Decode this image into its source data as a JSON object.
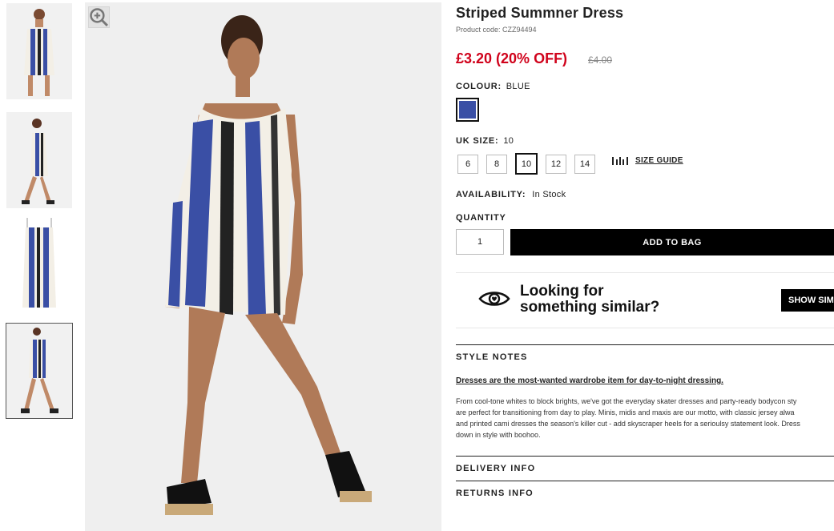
{
  "product": {
    "title": "Striped Summner Dress",
    "code": "Product code: CZZ94494",
    "price": "£3.20 (20% OFF)",
    "old_price": "£4.00"
  },
  "colour": {
    "label": "COLOUR:",
    "value": "BLUE",
    "swatch": "#3a4fa5"
  },
  "size": {
    "label": "UK SIZE:",
    "value": "10",
    "options": [
      "6",
      "8",
      "10",
      "12",
      "14"
    ],
    "guide": "SIZE GUIDE"
  },
  "availability": {
    "label": "AVAILABILITY:",
    "value": "In Stock"
  },
  "quantity": {
    "label": "QUANTITY",
    "value": "1"
  },
  "add_to_bag": "ADD TO BAG",
  "similar": {
    "line1": "Looking for",
    "line2": "something similar?",
    "button": "SHOW SIM"
  },
  "style_notes": {
    "heading": "STYLE NOTES",
    "lead": "Dresses are the most-wanted wardrobe item for day-to-night dressing.",
    "lines": [
      "From cool-tone whites to block brights, we've got the everyday skater dresses and party-ready bodycon sty",
      "are perfect for transitioning from day to play. Minis, midis and maxis are our motto, with classic jersey alwa",
      "and printed cami dresses the season's killer cut - add skyscraper heels for a serioulsy statement look. Dress",
      "down in style with boohoo."
    ]
  },
  "delivery": {
    "heading": "DELIVERY INFO"
  },
  "returns": {
    "heading": "RETURNS INFO"
  },
  "colors": {
    "accent_red": "#d0021b",
    "dress_blue": "#3a4fa5",
    "black": "#000000"
  }
}
